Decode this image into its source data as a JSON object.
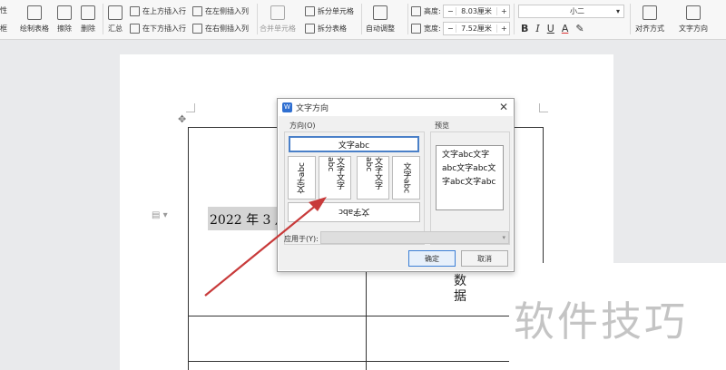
{
  "ribbon": {
    "left_partial_top": "性",
    "left_partial_bottom": "框",
    "draw_table": "绘制表格",
    "erase": "擦除",
    "delete": "删除",
    "summary": "汇总",
    "insert_above": "在上方插入行",
    "insert_below": "在下方插入行",
    "insert_left": "在左侧插入列",
    "insert_right": "在右侧插入列",
    "merge_cells": "合并单元格",
    "split_cells": "拆分单元格",
    "split_table": "拆分表格",
    "auto_fit": "自动调整",
    "height_label": "高度:",
    "height_value": "8.03厘米",
    "width_label": "宽度:",
    "width_value": "7.52厘米",
    "font_size": "小二",
    "bold": "B",
    "underline": "U",
    "align": "对齐方式",
    "text_direction": "文字方向"
  },
  "document": {
    "date_text": "2022 年 3 月",
    "cell_text": "数\n据"
  },
  "dialog": {
    "title": "文字方向",
    "direction_group": "方向(O)",
    "preview_group": "预览",
    "options": [
      "文字abc",
      "文字abc",
      "文字文字abc",
      "文字文字abc",
      "文字abc",
      "文字abc"
    ],
    "preview_text": "文字abc文字abc文字abc文字abc文字abc",
    "apply_label": "应用于(Y):",
    "ok": "确定",
    "cancel": "取消"
  },
  "watermark": "软件技巧",
  "colors": {
    "arrow": "#c83a3a",
    "selected_border": "#4a80c8",
    "date_highlight": "#d4d4d4"
  }
}
